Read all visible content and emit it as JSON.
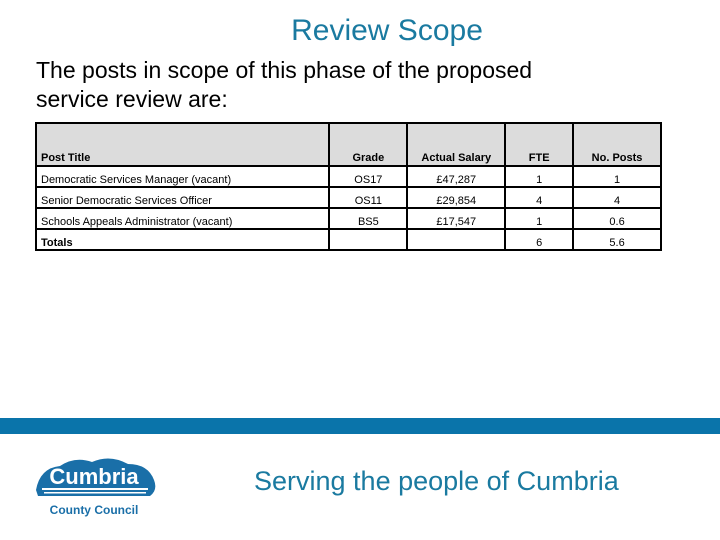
{
  "slide": {
    "title": "Review Scope",
    "intro": "The posts in scope of this phase of the proposed service review are:",
    "table": {
      "headers": [
        "Post Title",
        "Grade",
        "Actual Salary",
        "FTE",
        "No. Posts"
      ],
      "rows": [
        [
          "Democratic Services Manager (vacant)",
          "OS17",
          "£47,287",
          "1",
          "1"
        ],
        [
          "Senior Democratic Services Officer",
          "OS11",
          "£29,854",
          "4",
          "4"
        ],
        [
          "Schools Appeals Administrator (vacant)",
          "BS5",
          "£17,547",
          "1",
          "0.6"
        ]
      ],
      "totals": [
        "Totals",
        "",
        "",
        "6",
        "5.6"
      ]
    },
    "footer": {
      "logo_word": "Cumbria",
      "logo_sub": "County Council",
      "tagline": "Serving the people of Cumbria",
      "bar_color": "#0a74aa",
      "accent_color": "#1a7aa0"
    }
  }
}
